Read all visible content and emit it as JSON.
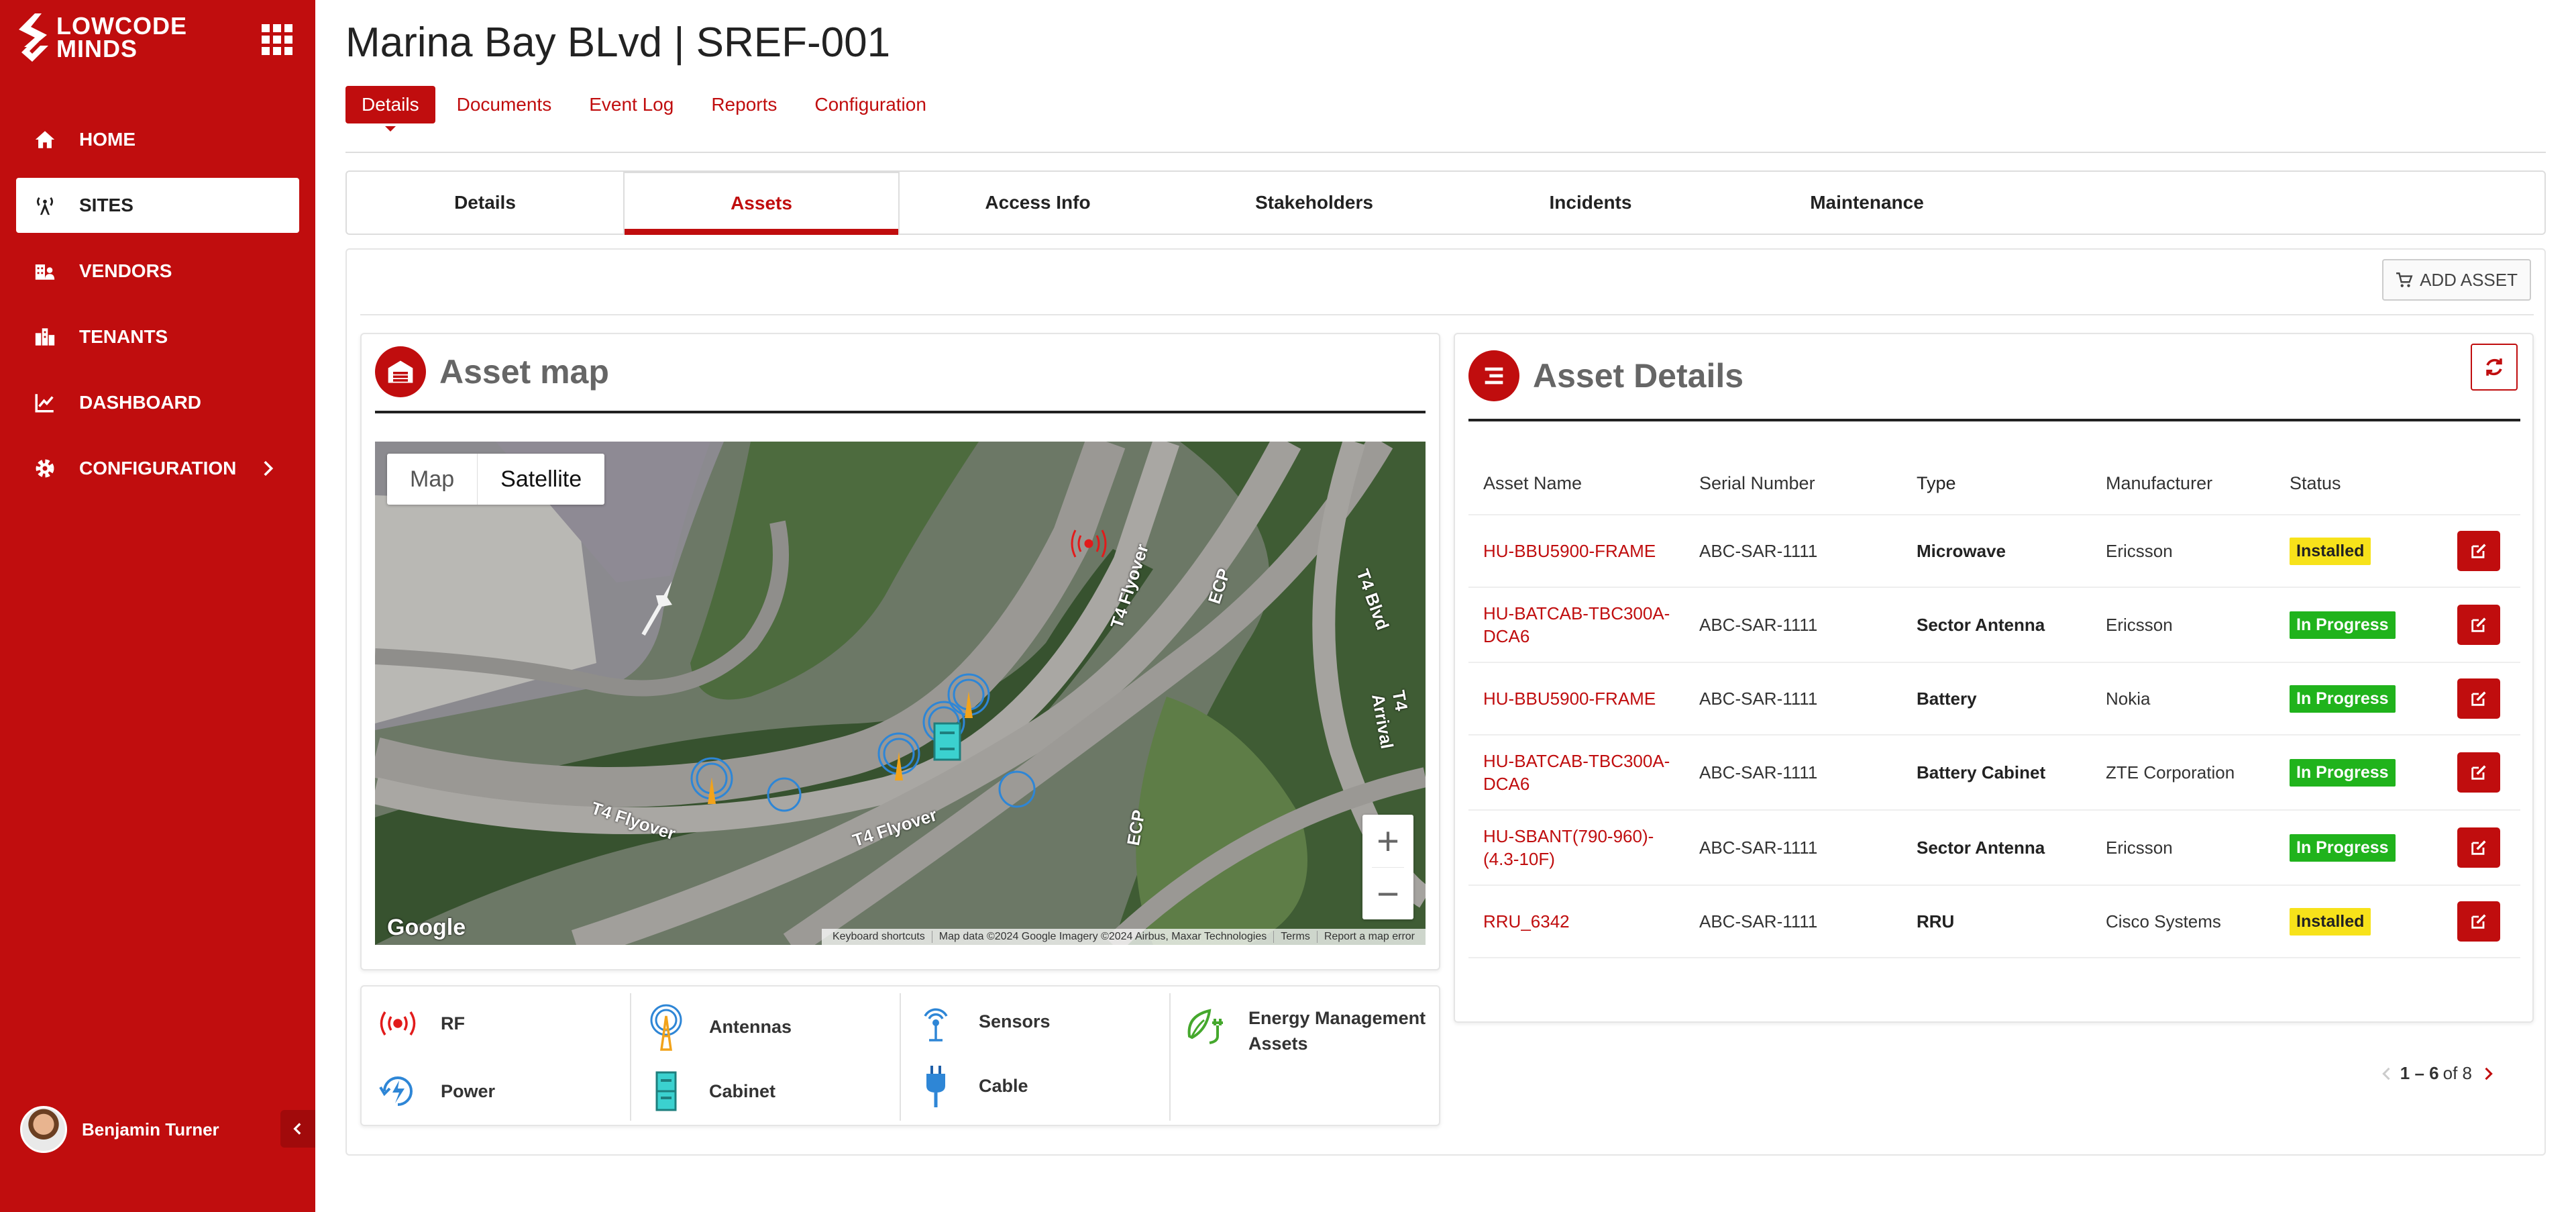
{
  "brand": {
    "line1": "LOWCODE",
    "line2": "MINDS"
  },
  "sidebar": {
    "items": [
      {
        "label": "HOME",
        "icon": "home-icon"
      },
      {
        "label": "SITES",
        "icon": "antenna-icon",
        "active": true
      },
      {
        "label": "VENDORS",
        "icon": "vendors-icon"
      },
      {
        "label": "TENANTS",
        "icon": "tenants-icon"
      },
      {
        "label": "DASHBOARD",
        "icon": "chart-icon"
      },
      {
        "label": "CONFIGURATION",
        "icon": "gear-icon"
      }
    ],
    "user_name": "Benjamin Turner"
  },
  "page": {
    "title": "Marina Bay BLvd | SREF-001",
    "tabs": [
      "Details",
      "Documents",
      "Event Log",
      "Reports",
      "Configuration"
    ],
    "active_tab": "Details"
  },
  "sub_tabs": {
    "items": [
      "Details",
      "Assets",
      "Access Info",
      "Stakeholders",
      "Incidents",
      "Maintenance"
    ],
    "active": "Assets"
  },
  "toolbar": {
    "add_asset_label": "ADD ASSET"
  },
  "asset_map": {
    "title": "Asset map",
    "map_type_options": [
      "Map",
      "Satellite"
    ],
    "selected_map_type": "Satellite",
    "road_labels": [
      "T4 Flyover",
      "T4 Flyover",
      "T4 Flyover",
      "ECP",
      "ECP",
      "T4 Blvd",
      "T4 Arrival"
    ],
    "attribution": [
      "Keyboard shortcuts",
      "Map data ©2024 Google Imagery ©2024 Airbus, Maxar Technologies",
      "Terms",
      "Report a map error"
    ],
    "google_label": "Google"
  },
  "legend": {
    "items": [
      "RF",
      "Power",
      "Antennas",
      "Cabinet",
      "Sensors",
      "Cable",
      "Energy Management Assets"
    ]
  },
  "asset_details": {
    "title": "Asset Details",
    "columns": [
      "Asset Name",
      "Serial Number",
      "Type",
      "Manufacturer",
      "Status"
    ],
    "rows": [
      {
        "name": "HU-BBU5900-FRAME",
        "serial": "ABC-SAR-1111",
        "type": "Microwave",
        "manufacturer": "Ericsson",
        "status": "Installed"
      },
      {
        "name": "HU-BATCAB-TBC300A-DCA6",
        "serial": "ABC-SAR-1111",
        "type": "Sector Antenna",
        "manufacturer": "Ericsson",
        "status": "In Progress"
      },
      {
        "name": "HU-BBU5900-FRAME",
        "serial": "ABC-SAR-1111",
        "type": "Battery",
        "manufacturer": "Nokia",
        "status": "In Progress"
      },
      {
        "name": "HU-BATCAB-TBC300A-DCA6",
        "serial": "ABC-SAR-1111",
        "type": "Battery Cabinet",
        "manufacturer": "ZTE Corporation",
        "status": "In Progress"
      },
      {
        "name": "HU-SBANT(790-960)-(4.3-10F)",
        "serial": "ABC-SAR-1111",
        "type": "Sector Antenna",
        "manufacturer": "Ericsson",
        "status": "In Progress"
      },
      {
        "name": "RRU_6342",
        "serial": "ABC-SAR-1111",
        "type": "RRU",
        "manufacturer": "Cisco Systems",
        "status": "Installed"
      }
    ],
    "pagination": {
      "range": "1 – 6",
      "of_label": "of 8"
    }
  },
  "colors": {
    "brand": "#c00d0e",
    "installed": "#f7e21a",
    "in_progress": "#20b31c"
  }
}
